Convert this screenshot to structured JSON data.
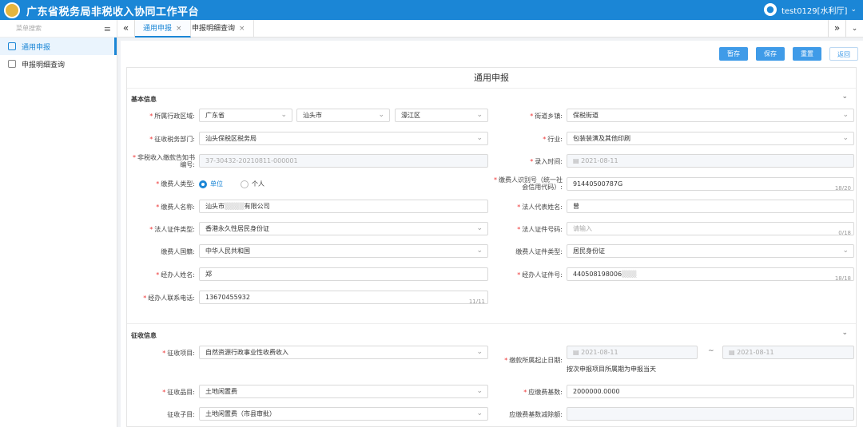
{
  "header": {
    "app_title": "广东省税务局非税收入协同工作平台",
    "user": "test0129[水利厅]"
  },
  "sidebar": {
    "search_placeholder": "菜单搜索",
    "items": [
      {
        "label": "通用申报"
      },
      {
        "label": "申报明细查询"
      }
    ]
  },
  "tabs": [
    {
      "label": "通用申报"
    },
    {
      "label": "申报明细查询"
    }
  ],
  "actions": {
    "save_temp": "暂存",
    "save": "保存",
    "reset": "重置",
    "back": "返回"
  },
  "form": {
    "title": "通用申报",
    "basic": {
      "section": "基本信息",
      "region_label": "所属行政区域:",
      "province": "广东省",
      "city": "汕头市",
      "district": "濠江区",
      "street_label": "街道乡镇:",
      "street": "保税街道",
      "tax_dept_label": "征收税务部门:",
      "tax_dept": "汕头保税区税务局",
      "industry_label": "行业:",
      "industry": "包装装潢及其他印刷",
      "notice_no_label": "非税收入缴款告知书编号:",
      "notice_no": "37-30432-20210811-000001",
      "entry_time_label": "录入时间:",
      "entry_time": "2021-08-11",
      "payer_type_label": "缴费人类型:",
      "payer_type_unit": "单位",
      "payer_type_person": "个人",
      "payer_id_label": "缴费人识别号（统一社会信用代码）:",
      "payer_id": "91440500787G",
      "payer_id_count": "18/20",
      "payer_name_label": "缴费人名称:",
      "payer_name": "汕头市",
      "payer_name_suffix": "有限公司",
      "legal_rep_label": "法人代表姓名:",
      "legal_rep": "曾",
      "legal_cert_type_label": "法人证件类型:",
      "legal_cert_type": "香港永久性居民身份证",
      "legal_cert_no_label": "法人证件号码:",
      "legal_cert_no_placeholder": "请输入",
      "legal_cert_no_count": "0/18",
      "nationality_label": "缴费人国籍:",
      "nationality": "中华人民共和国",
      "payer_cert_type_label": "缴费人证件类型:",
      "payer_cert_type": "居民身份证",
      "handler_name_label": "经办人姓名:",
      "handler_name": "郑",
      "handler_cert_no_label": "经办人证件号:",
      "handler_cert_no": "440508198006",
      "handler_cert_no_count": "18/18",
      "handler_phone_label": "经办人联系电话:",
      "handler_phone": "13670455932",
      "handler_phone_count": "11/11"
    },
    "collect": {
      "section": "征收信息",
      "item_label": "征收项目:",
      "item": "自然资源行政事业性收费收入",
      "period_label": "缴款所属起止日期:",
      "period_start": "2021-08-11",
      "period_sep": "~",
      "period_end": "2021-08-11",
      "period_note": "按次申报项目所属期为申报当天",
      "category_label": "征收品目:",
      "category": "土地闲置费",
      "base_label": "应缴费基数:",
      "base": "2000000.0000",
      "sub_label": "征收子目:",
      "sub": "土地闲置费（市县审批）",
      "deduct_label": "应缴费基数减除额:",
      "deduct": ""
    }
  }
}
